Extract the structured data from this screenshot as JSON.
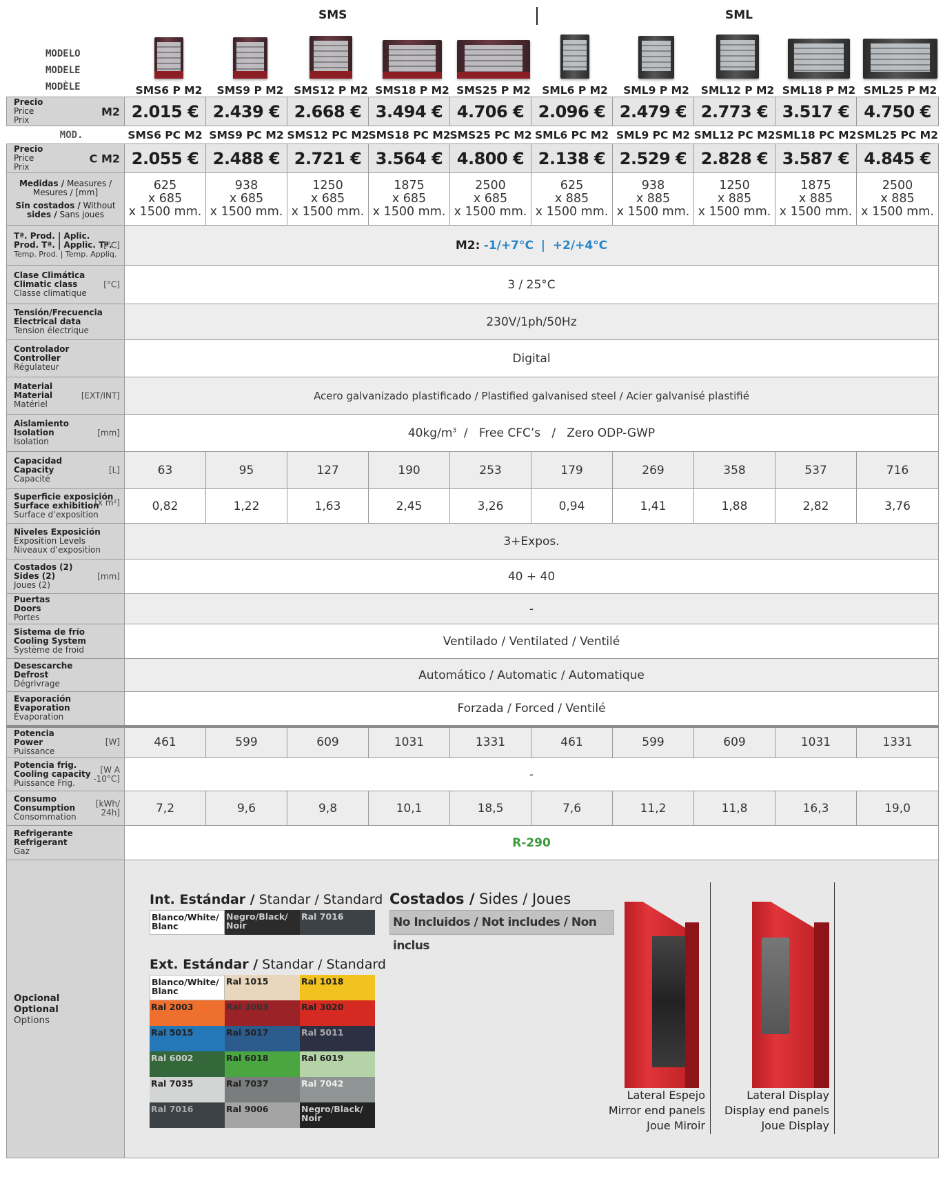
{
  "groups": {
    "sms": "SMS",
    "sml": "SML"
  },
  "modelo_labels": [
    "MODELO",
    "MODELE",
    "MODÈLE"
  ],
  "models": [
    "SMS6 P M2",
    "SMS9 P M2",
    "SMS12 P M2",
    "SMS18 P M2",
    "SMS25 P M2",
    "SML6 P M2",
    "SML9 P M2",
    "SML12 P M2",
    "SML18 P M2",
    "SML25 P M2"
  ],
  "price_m2": {
    "l1": "Precio",
    "l2": "Price",
    "l3": "Prix",
    "unit": "M2",
    "values": [
      "2.015 €",
      "2.439 €",
      "2.668 €",
      "3.494 €",
      "4.706 €",
      "2.096 €",
      "2.479 €",
      "2.773 €",
      "3.517 €",
      "4.750 €"
    ]
  },
  "mod_label": "MOD.",
  "models_pc": [
    "SMS6 PC M2",
    "SMS9 PC M2",
    "SMS12 PC M2",
    "SMS18 PC M2",
    "SMS25 PC M2",
    "SML6 PC M2",
    "SML9 PC M2",
    "SML12 PC M2",
    "SML18 PC M2",
    "SML25 PC M2"
  ],
  "price_cm2": {
    "l1": "Precio",
    "l2": "Price",
    "l3": "Prix",
    "unit": "C M2",
    "values": [
      "2.055 €",
      "2.488 €",
      "2.721 €",
      "3.564 €",
      "4.800 €",
      "2.138 €",
      "2.529 €",
      "2.828 €",
      "3.587 €",
      "4.845 €"
    ]
  },
  "measures": {
    "l1a": "Medidas /",
    "l1b": " Measures /",
    "l2": "Mesures / [mm]",
    "l3a": "Sin costados /",
    "l3b": " Without",
    "l4a": "sides /",
    "l4b": " Sans joues",
    "widths": [
      "625",
      "938",
      "1250",
      "1875",
      "2500",
      "625",
      "938",
      "1250",
      "1875",
      "2500"
    ],
    "depths": [
      "x 685",
      "x 685",
      "x 685",
      "x 685",
      "x 685",
      "x 885",
      "x 885",
      "x 885",
      "x 885",
      "x 885"
    ],
    "heights": [
      "x 1500 mm.",
      "x 1500 mm.",
      "x 1500 mm.",
      "x 1500 mm.",
      "x 1500 mm.",
      "x 1500 mm.",
      "x 1500 mm.",
      "x 1500 mm.",
      "x 1500 mm.",
      "x 1500 mm."
    ]
  },
  "temp": {
    "l1": "Tª. Prod. | Aplic.",
    "l2": "Prod. Tª. | Applic. Tª.",
    "unit": "[°C]",
    "l3": "Temp. Prod. | Temp. Appliq.",
    "prefix": "M2:",
    "v1": "-1/+7°C",
    "sep": "|",
    "v2": "+2/+4°C"
  },
  "climate": {
    "l1": "Clase Climática",
    "l2": "Climatic class",
    "unit": "[°C]",
    "l3": "Classe climatique",
    "value": "3 / 25°C"
  },
  "voltage": {
    "l1": "Tensión/Frecuencia",
    "l2": "Electrical data",
    "l3": "Tension électrique",
    "value": "230V/1ph/50Hz"
  },
  "controller": {
    "l1": "Controlador",
    "l2": "Controller",
    "l3": "Régulateur",
    "value": "Digital"
  },
  "material": {
    "l1": "Material",
    "l2": "Material",
    "unit": "[EXT/INT]",
    "l3": "Matériel",
    "value": "Acero galvanizado plastificado / Plastified galvanised steel / Acier galvanisé plastifié"
  },
  "isolation": {
    "l1": "Aislamiento",
    "l2": "Isolation",
    "unit": "[mm]",
    "l3": "Isolation",
    "value_a": "40kg/m",
    "value_sup": "3",
    "value_b": "  /   Free CFC’s   /   Zero ODP-GWP"
  },
  "capacity": {
    "l1": "Capacidad",
    "l2": "Capacity",
    "unit": "[L]",
    "l3": "Capacité",
    "values": [
      "63",
      "95",
      "127",
      "190",
      "253",
      "179",
      "269",
      "358",
      "537",
      "716"
    ]
  },
  "surface": {
    "l1": "Superficie exposición",
    "l2": "Surface exhibition",
    "unit": "[x m²]",
    "l3": "Surface d’exposition",
    "values": [
      "0,82",
      "1,22",
      "1,63",
      "2,45",
      "3,26",
      "0,94",
      "1,41",
      "1,88",
      "2,82",
      "3,76"
    ]
  },
  "levels": {
    "l1": "Niveles Exposición",
    "l2": "Exposition Levels",
    "l3": "Niveaux d’exposition",
    "value": "3+Expos."
  },
  "sides": {
    "l1": "Costados (2)",
    "l2": "Sides (2)",
    "unit": "[mm]",
    "l3": "Joues (2)",
    "value": "40 + 40"
  },
  "doors": {
    "l1": "Puertas",
    "l2": "Doors",
    "l3": "Portes",
    "value": "-"
  },
  "cooling": {
    "l1": "Sistema de frío",
    "l2": "Cooling System",
    "l3": "Système de froid",
    "value": "Ventilado / Ventilated / Ventilé"
  },
  "defrost": {
    "l1": "Desescarche",
    "l2": "Defrost",
    "l3": "Dégrivrage",
    "value": "Automático / Automatic / Automatique"
  },
  "evaporation": {
    "l1": "Evaporación",
    "l2": "Evaporation",
    "l3": "Évaporation",
    "value": "Forzada / Forced / Ventilé"
  },
  "power": {
    "l1": "Potencia",
    "l2": "Power",
    "unit": "[W]",
    "l3": "Puissance",
    "values": [
      "461",
      "599",
      "609",
      "1031",
      "1331",
      "461",
      "599",
      "609",
      "1031",
      "1331"
    ]
  },
  "cooling_cap": {
    "l1": "Potencia frig.",
    "l2": "Cooling capacity",
    "unit1": "[W A",
    "unit2": "-10°C]",
    "l3": "Puissance Frig.",
    "value": "-"
  },
  "consumption": {
    "l1": "Consumo",
    "l2": "Consumption",
    "unit1": "[kWh/",
    "unit2": "24h]",
    "l3": "Consommation",
    "values": [
      "7,2",
      "9,6",
      "9,8",
      "10,1",
      "18,5",
      "7,6",
      "11,2",
      "11,8",
      "16,3",
      "19,0"
    ]
  },
  "refrigerant": {
    "l1": "Refrigerante",
    "l2": "Refrigerant",
    "l3": "Gaz",
    "value": "R-290"
  },
  "options": {
    "l1": "Opcional",
    "l2": "Optional",
    "l3": "Options",
    "int_title_a": "Int. Estándar /",
    "int_title_b": " Standar /",
    "int_title_c": " Standard",
    "int_swatches": [
      {
        "label": "Blanco/White/ Blanc",
        "color": "#ffffff",
        "text": "#222222"
      },
      {
        "label": "Negro/Black/ Noir",
        "color": "#2b2b2b",
        "text": "#cccccc"
      },
      {
        "label": "Ral 7016",
        "color": "#3d4247",
        "text": "#cccccc"
      }
    ],
    "ext_title_a": "Ext. Estándar /",
    "ext_title_b": " Standar /",
    "ext_title_c": " Standard",
    "ext_swatches": [
      {
        "label": "Blanco/White/ Blanc",
        "color": "#ffffff",
        "text": "#222222"
      },
      {
        "label": "Ral 1015",
        "color": "#e8d7bd",
        "text": "#222222"
      },
      {
        "label": "Ral 1018",
        "color": "#f2c21f",
        "text": "#222222"
      },
      {
        "label": "Ral 2003",
        "color": "#ef6f2e",
        "text": "#222222"
      },
      {
        "label": "Ral 3003",
        "color": "#9b2226",
        "text": "#333333"
      },
      {
        "label": "Ral 3020",
        "color": "#d42a22",
        "text": "#222222"
      },
      {
        "label": "Ral 5015",
        "color": "#2478b7",
        "text": "#222222"
      },
      {
        "label": "Ral 5017",
        "color": "#2c5b8e",
        "text": "#222222"
      },
      {
        "label": "Ral 5011",
        "color": "#2b3042",
        "text": "#aaaaaa"
      },
      {
        "label": "Ral 6002",
        "color": "#34673a",
        "text": "#cccccc"
      },
      {
        "label": "Ral 6018",
        "color": "#4aa640",
        "text": "#222222"
      },
      {
        "label": "Ral 6019",
        "color": "#b4d3a6",
        "text": "#222222"
      },
      {
        "label": "Ral 7035",
        "color": "#d3d5d4",
        "text": "#222222"
      },
      {
        "label": "Ral 7037",
        "color": "#7a7c7d",
        "text": "#222222"
      },
      {
        "label": "Ral 7042",
        "color": "#8f9494",
        "text": "#eeeeee"
      },
      {
        "label": "Ral 7016",
        "color": "#3d4247",
        "text": "#aaaaaa"
      },
      {
        "label": "Ral 9006",
        "color": "#a3a4a3",
        "text": "#222222"
      },
      {
        "label": "Negro/Black/ Noir",
        "color": "#222222",
        "text": "#cccccc"
      }
    ],
    "sides_title_a": "Costados /",
    "sides_title_b": " Sides /",
    "sides_title_c": " Joues",
    "sides_note": "No Incluidos / Not includes / Non inclus",
    "mirror_caption": [
      "Lateral Espejo",
      "Mirror end panels",
      "Joue Miroir"
    ],
    "display_caption": [
      "Lateral Display",
      "Display end panels",
      "Joue Display"
    ]
  }
}
